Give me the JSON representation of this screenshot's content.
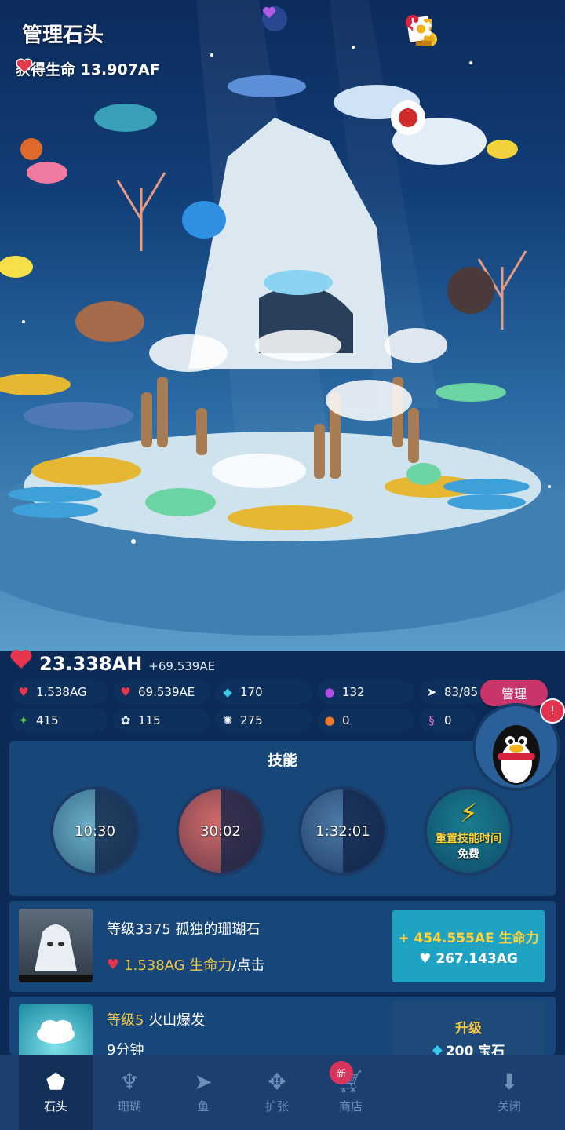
{
  "header": {
    "title": "管理石头",
    "life_label": "获得生命 13.907AF"
  },
  "resources": {
    "life_total": "23.338AH",
    "life_rate": "+69.539AE",
    "row1": [
      {
        "icon": "tap-heart-icon",
        "value": "1.538AG"
      },
      {
        "icon": "heart-timer-icon",
        "value": "69.539AE"
      },
      {
        "icon": "diamond-icon",
        "value": "170"
      },
      {
        "icon": "purple-pearl-icon",
        "value": "132"
      },
      {
        "icon": "fish-icon",
        "value": "83/85"
      }
    ],
    "row2": [
      {
        "icon": "green-coral-icon",
        "value": "415"
      },
      {
        "icon": "white-coral-icon",
        "value": "115"
      },
      {
        "icon": "urchin-icon",
        "value": "275"
      },
      {
        "icon": "crab-icon",
        "value": "0"
      },
      {
        "icon": "seahorse-icon",
        "value": "0"
      }
    ],
    "manage_label": "管理"
  },
  "skills": {
    "title": "技能",
    "timers": [
      "10:30",
      "30:02",
      "1:32:01"
    ],
    "reset_label": "重置技能时间",
    "reset_free": "免费"
  },
  "upgrades": [
    {
      "level": "等级3375",
      "name": "孤独的珊瑚石",
      "stat_value": "1.538AG 生命力",
      "stat_suffix": "/点击",
      "buy_top": "+ 454.555AE 生命力",
      "buy_cost": "267.143AG"
    },
    {
      "level": "等级5",
      "name": "火山爆发",
      "duration": "9分钟",
      "buy_top": "升级",
      "buy_cost": "200 宝石"
    }
  ],
  "nav": [
    {
      "label": "石头",
      "icon": "rock-icon",
      "active": true
    },
    {
      "label": "珊瑚",
      "icon": "coral-icon"
    },
    {
      "label": "鱼",
      "icon": "fish-icon"
    },
    {
      "label": "扩张",
      "icon": "expand-icon"
    },
    {
      "label": "商店",
      "icon": "cart-icon",
      "badge": "新"
    },
    {
      "label": "关闭",
      "icon": "close-icon"
    }
  ],
  "qq_badge": "!"
}
